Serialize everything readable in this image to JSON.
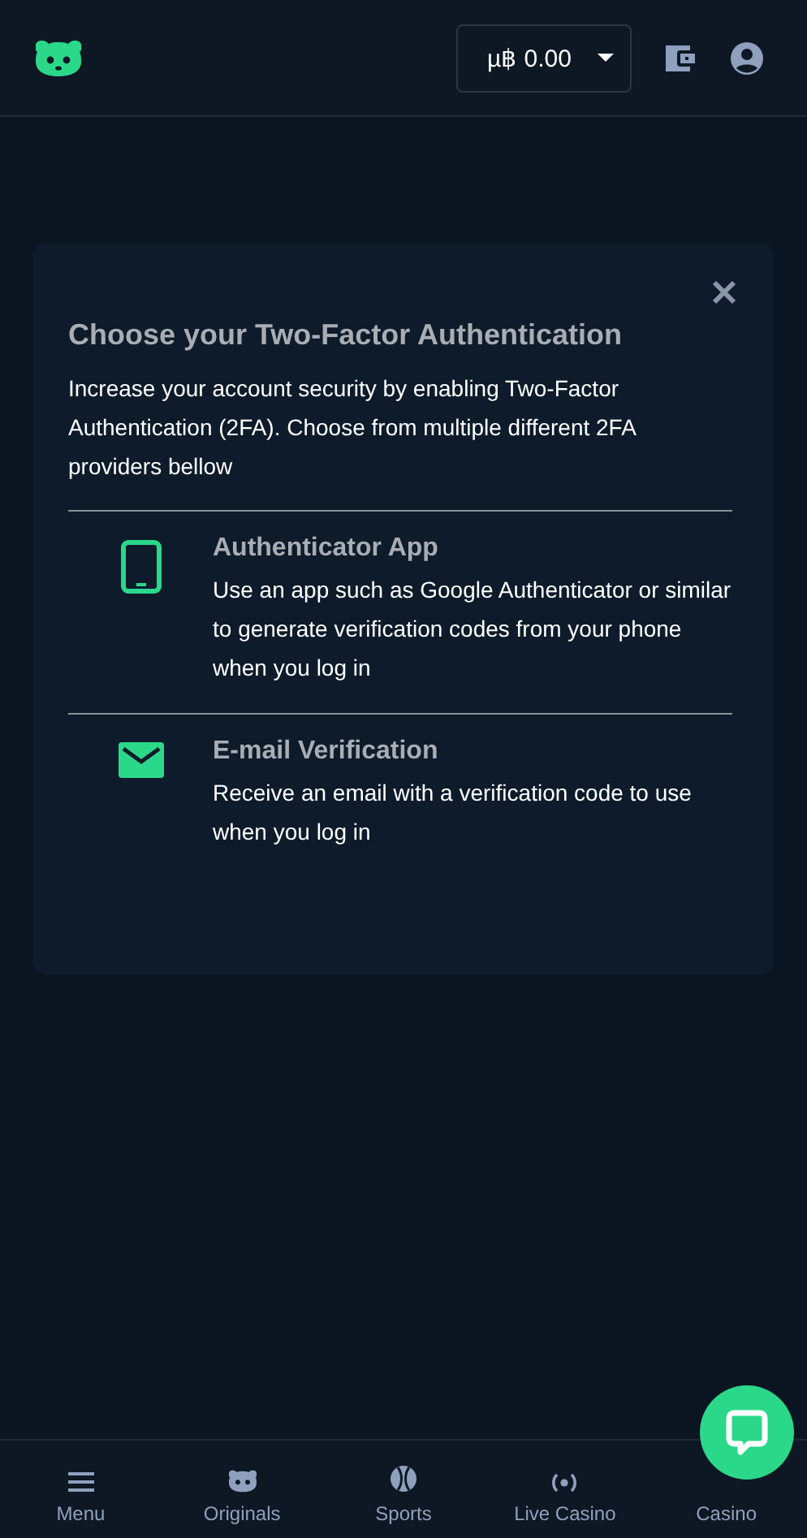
{
  "header": {
    "balance": "µ฿ 0.00"
  },
  "modal": {
    "title": "Choose your Two-Factor Authentication",
    "description": "Increase your account security by enabling Two-Factor Authentication (2FA). Choose from multiple different 2FA providers bellow",
    "options": [
      {
        "kind": "app",
        "title": "Authenticator App",
        "description": "Use an app such as Google Authenticator or similar to generate verification codes from your phone when you log in"
      },
      {
        "kind": "email",
        "title": "E-mail Verification",
        "description": "Receive an email with a verification code to use when you log in"
      }
    ]
  },
  "bottom_nav": [
    {
      "kind": "menu",
      "label": "Menu"
    },
    {
      "kind": "originals",
      "label": "Originals"
    },
    {
      "kind": "sports",
      "label": "Sports"
    },
    {
      "kind": "live",
      "label": "Live Casino"
    },
    {
      "kind": "casino",
      "label": "Casino"
    }
  ]
}
